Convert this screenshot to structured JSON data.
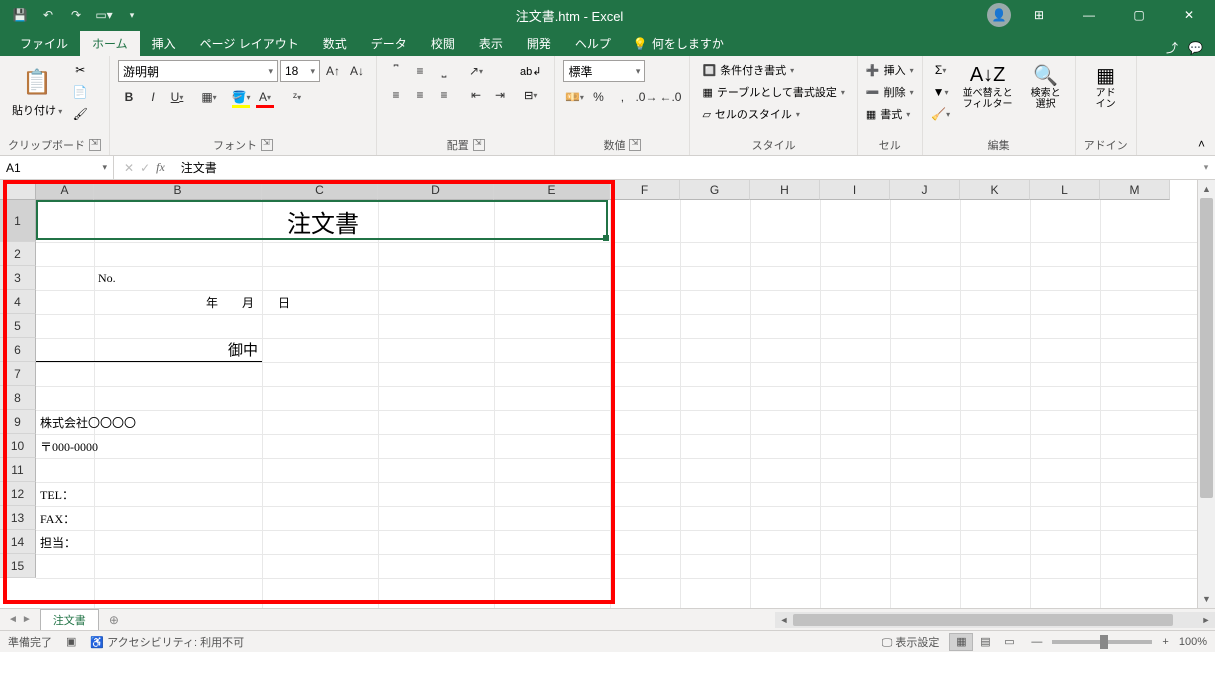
{
  "app": {
    "title": "注文書.htm - Excel"
  },
  "qat": {
    "save": "保存",
    "undo": "元に戻す",
    "redo": "やり直し",
    "touch": "タッチ"
  },
  "winctl": {
    "min": "最小化",
    "restore": "元に戻す",
    "close": "閉じる"
  },
  "tabs": [
    "ファイル",
    "ホーム",
    "挿入",
    "ページ レイアウト",
    "数式",
    "データ",
    "校閲",
    "表示",
    "開発",
    "ヘルプ"
  ],
  "tellme": "何をしますか",
  "ribbon": {
    "clipboard": {
      "paste": "貼り付け",
      "label": "クリップボード"
    },
    "font": {
      "name": "游明朝",
      "size": "18",
      "label": "フォント",
      "bold": "B",
      "italic": "I",
      "underline": "U"
    },
    "alignment": {
      "label": "配置",
      "wrap": "折返",
      "merge": "結合"
    },
    "number": {
      "format": "標準",
      "label": "数値"
    },
    "styles": {
      "cond": "条件付き書式",
      "table": "テーブルとして書式設定",
      "cell": "セルのスタイル",
      "label": "スタイル"
    },
    "cells": {
      "insert": "挿入",
      "delete": "削除",
      "format": "書式",
      "label": "セル"
    },
    "editing": {
      "sort": "並べ替えと\nフィルター",
      "find": "検索と\n選択",
      "label": "編集"
    },
    "addin": {
      "btn": "アド\nイン",
      "label": "アドイン"
    }
  },
  "namebox": "A1",
  "formula": "注文書",
  "sheet_tab": "注文書",
  "status": {
    "ready": "準備完了",
    "accessibility": "アクセシビリティ: 利用不可",
    "display": "表示設定",
    "zoom": "100%"
  },
  "grid": {
    "cols": [
      "A",
      "B",
      "C",
      "D",
      "E",
      "F",
      "G",
      "H",
      "I",
      "J",
      "K",
      "L",
      "M"
    ],
    "rows": [
      1,
      2,
      3,
      4,
      5,
      6,
      7,
      8,
      9,
      10,
      11,
      12,
      13,
      14,
      15
    ],
    "cells": {
      "title": "注文書",
      "no_label": "No.",
      "date": "年　　月　　日",
      "onchu": "御中",
      "company": "株式会社〇〇〇〇",
      "postal": "〒000-0000",
      "tel": "TEL：",
      "fax": "FAX：",
      "tanto": "担当："
    }
  }
}
